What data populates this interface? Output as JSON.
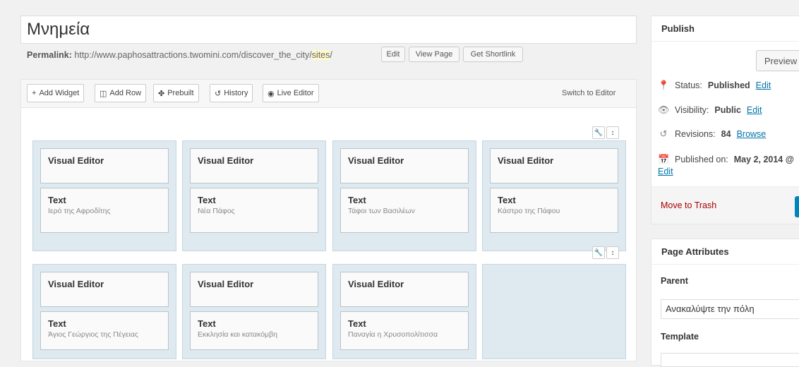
{
  "page": {
    "title": "Μνημεία",
    "permalink_label": "Permalink:",
    "permalink_url": "http://www.paphosattractions.twomini.com/discover_the_city/",
    "permalink_slug": "sites",
    "permalink_trailing": "/",
    "edit_btn": "Edit",
    "view_btn": "View Page",
    "shortlink_btn": "Get Shortlink"
  },
  "toolbar": {
    "add_widget": "Add Widget",
    "add_row": "Add Row",
    "prebuilt": "Prebuilt",
    "history": "History",
    "live_editor": "Live Editor",
    "switch": "Switch to Editor"
  },
  "rows": [
    {
      "cells": [
        {
          "w1": "Visual Editor",
          "w2": "Text",
          "w2_desc": "Ιερό της Αφροδίτης"
        },
        {
          "w1": "Visual Editor",
          "w2": "Text",
          "w2_desc": "Νέα Πάφος"
        },
        {
          "w1": "Visual Editor",
          "w2": "Text",
          "w2_desc": "Τάφοι των Βασιλέων"
        },
        {
          "w1": "Visual Editor",
          "w2": "Text",
          "w2_desc": "Κάστρο της Πάφου"
        }
      ]
    },
    {
      "cells": [
        {
          "w1": "Visual Editor",
          "w2": "Text",
          "w2_desc": "Άγιος Γεώργιος της Πέγειας"
        },
        {
          "w1": "Visual Editor",
          "w2": "Text",
          "w2_desc": "Εκκλησία και κατακόμβη"
        },
        {
          "w1": "Visual Editor",
          "w2": "Text",
          "w2_desc": "Παναγία η Χρυσοπολίτισσα"
        }
      ]
    }
  ],
  "publish": {
    "heading": "Publish",
    "preview": "Preview",
    "status_label": "Status:",
    "status_value": "Published",
    "visibility_label": "Visibility:",
    "visibility_value": "Public",
    "revisions_label": "Revisions:",
    "revisions_value": "84",
    "browse": "Browse",
    "edit": "Edit",
    "published_on_label": "Published on:",
    "published_on_value": "May 2, 2014 @",
    "trash": "Move to Trash"
  },
  "attributes": {
    "heading": "Page Attributes",
    "parent_label": "Parent",
    "parent_value": "Ανακαλύψτε την πόλη",
    "template_label": "Template"
  }
}
